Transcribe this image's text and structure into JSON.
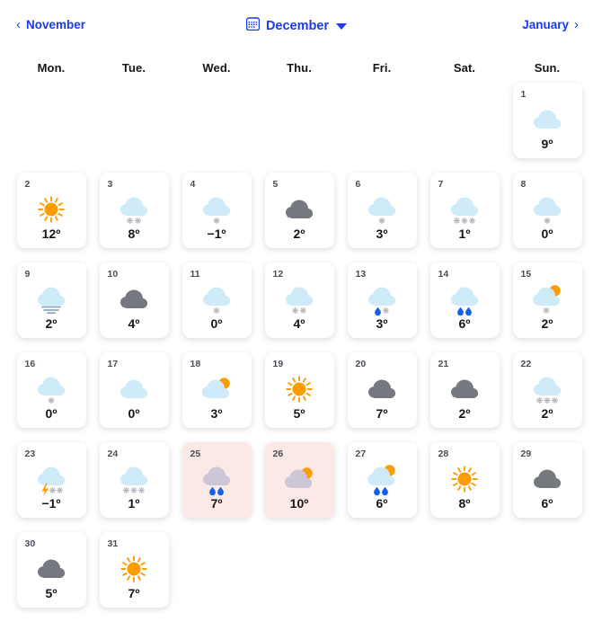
{
  "header": {
    "prev_month": "November",
    "current_month": "December",
    "next_month": "January",
    "prev_icon": "chevron-left-icon",
    "next_icon": "chevron-right-icon",
    "calendar_icon": "calendar-icon",
    "dropdown_icon": "chevron-down-icon"
  },
  "weekdays": [
    "Mon.",
    "Tue.",
    "Wed.",
    "Thu.",
    "Fri.",
    "Sat.",
    "Sun."
  ],
  "colors": {
    "accent_blue": "#1a3bf0",
    "cloud_light": "#cfeaf9",
    "cloud_gray": "#75787f",
    "sun_orange": "#ff9d00",
    "rain_blue": "#1560e8",
    "snow_gray": "#b9bcc4",
    "highlight_pink": "#fce8e4",
    "text_dark": "#15161a",
    "daynum_gray": "#4a4d58"
  },
  "leading_blanks": 6,
  "days": [
    {
      "day": "1",
      "temp": "9º",
      "icon": "cloud",
      "highlight": false
    },
    {
      "day": "2",
      "temp": "12º",
      "icon": "sun",
      "highlight": false
    },
    {
      "day": "3",
      "temp": "8º",
      "icon": "snow-2",
      "highlight": false
    },
    {
      "day": "4",
      "temp": "−1º",
      "icon": "snow-1",
      "highlight": false
    },
    {
      "day": "5",
      "temp": "2º",
      "icon": "cloud-gray",
      "highlight": false
    },
    {
      "day": "6",
      "temp": "3º",
      "icon": "snow-1",
      "highlight": false
    },
    {
      "day": "7",
      "temp": "1º",
      "icon": "snow-3",
      "highlight": false
    },
    {
      "day": "8",
      "temp": "0º",
      "icon": "snow-1",
      "highlight": false
    },
    {
      "day": "9",
      "temp": "2º",
      "icon": "fog",
      "highlight": false
    },
    {
      "day": "10",
      "temp": "4º",
      "icon": "cloud-gray",
      "highlight": false
    },
    {
      "day": "11",
      "temp": "0º",
      "icon": "snow-1",
      "highlight": false
    },
    {
      "day": "12",
      "temp": "4º",
      "icon": "snow-2",
      "highlight": false
    },
    {
      "day": "13",
      "temp": "3º",
      "icon": "rain-snow",
      "highlight": false
    },
    {
      "day": "14",
      "temp": "6º",
      "icon": "rain-2",
      "highlight": false
    },
    {
      "day": "15",
      "temp": "2º",
      "icon": "partly-snow",
      "highlight": false
    },
    {
      "day": "16",
      "temp": "0º",
      "icon": "snow-1",
      "highlight": false
    },
    {
      "day": "17",
      "temp": "0º",
      "icon": "cloud",
      "highlight": false
    },
    {
      "day": "18",
      "temp": "3º",
      "icon": "partly-sunny",
      "highlight": false
    },
    {
      "day": "19",
      "temp": "5º",
      "icon": "sun",
      "highlight": false
    },
    {
      "day": "20",
      "temp": "7º",
      "icon": "cloud-gray",
      "highlight": false
    },
    {
      "day": "21",
      "temp": "2º",
      "icon": "cloud-gray",
      "highlight": false
    },
    {
      "day": "22",
      "temp": "2º",
      "icon": "snow-3",
      "highlight": false
    },
    {
      "day": "23",
      "temp": "−1º",
      "icon": "thunder-snow",
      "highlight": false
    },
    {
      "day": "24",
      "temp": "1º",
      "icon": "snow-3",
      "highlight": false
    },
    {
      "day": "25",
      "temp": "7º",
      "icon": "rain-2",
      "highlight": true
    },
    {
      "day": "26",
      "temp": "10º",
      "icon": "partly-sunny",
      "highlight": true
    },
    {
      "day": "27",
      "temp": "6º",
      "icon": "partly-rain",
      "highlight": false
    },
    {
      "day": "28",
      "temp": "8º",
      "icon": "sun",
      "highlight": false
    },
    {
      "day": "29",
      "temp": "6º",
      "icon": "cloud-gray",
      "highlight": false
    },
    {
      "day": "30",
      "temp": "5º",
      "icon": "cloud-gray",
      "highlight": false
    },
    {
      "day": "31",
      "temp": "7º",
      "icon": "sun",
      "highlight": false
    }
  ]
}
